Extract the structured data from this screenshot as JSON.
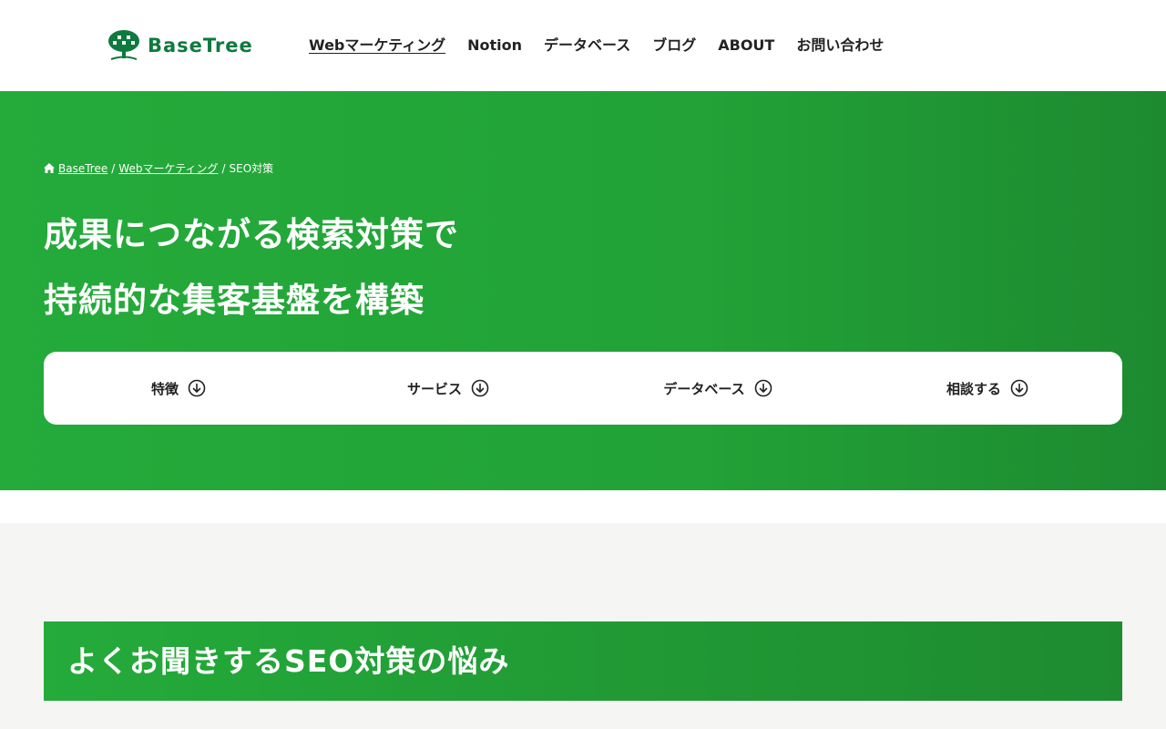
{
  "header": {
    "logo_text": "BaseTree",
    "nav": [
      {
        "label": "Webマーケティング",
        "active": true
      },
      {
        "label": "Notion"
      },
      {
        "label": "データベース"
      },
      {
        "label": "ブログ"
      },
      {
        "label": "ABOUT"
      },
      {
        "label": "お問い合わせ"
      }
    ]
  },
  "breadcrumb": {
    "home": "BaseTree",
    "sep1": "/",
    "level1": "Webマーケティング",
    "sep2": "/",
    "current": "SEO対策"
  },
  "hero": {
    "title_line1": "成果につながる検索対策で",
    "title_line2": "持続的な集客基盤を構築"
  },
  "anchors": [
    {
      "label": "特徴",
      "icon": "arrow-down-circle-icon"
    },
    {
      "label": "サービス",
      "icon": "arrow-down-circle-icon"
    },
    {
      "label": "データベース",
      "icon": "arrow-down-circle-icon"
    },
    {
      "label": "相談する",
      "icon": "arrow-down-circle-icon"
    }
  ],
  "section": {
    "heading": "よくお聞きするSEO対策の悩み"
  },
  "colors": {
    "brand_green": "#22a237",
    "logo_green": "#0d7a3e",
    "background": "#f5f5f4"
  }
}
